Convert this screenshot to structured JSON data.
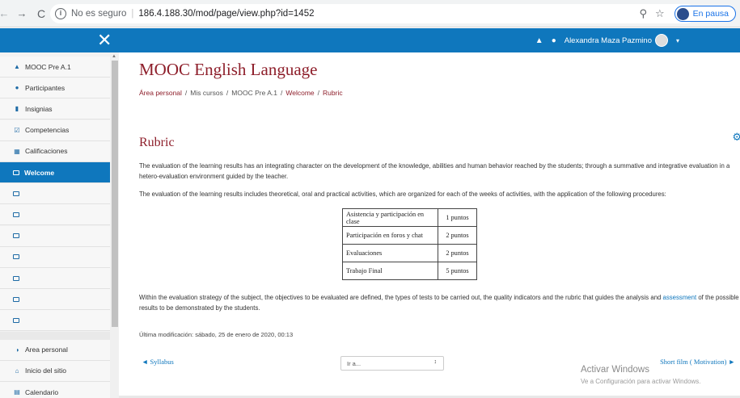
{
  "browser": {
    "back_glyph": "←",
    "forward_glyph": "→",
    "reload_glyph": "C",
    "info_glyph": "i",
    "not_secure": "No es seguro",
    "url": "186.4.188.30/mod/page/view.php?id=1452",
    "pause_label": "En pausa"
  },
  "navbar": {
    "close_glyph": "✕",
    "user_name": "Alexandra Maza Pazmino",
    "caret_glyph": "▾"
  },
  "sidebar": {
    "items": [
      {
        "label": "MOOC Pre A.1",
        "icon": "graduation-cap-icon",
        "glyph": "▲"
      },
      {
        "label": "Participantes",
        "icon": "users-icon",
        "glyph": "●"
      },
      {
        "label": "Insignias",
        "icon": "shield-icon",
        "glyph": "▮"
      },
      {
        "label": "Competencias",
        "icon": "checkbox-icon",
        "glyph": "☑"
      },
      {
        "label": "Calificaciones",
        "icon": "table-icon",
        "glyph": "▦"
      },
      {
        "label": "Welcome",
        "icon": "folder-icon",
        "active": true
      },
      {
        "label": "",
        "icon": "folder-icon"
      },
      {
        "label": "",
        "icon": "folder-icon"
      },
      {
        "label": "",
        "icon": "folder-icon"
      },
      {
        "label": "",
        "icon": "folder-icon"
      },
      {
        "label": "",
        "icon": "folder-icon"
      },
      {
        "label": "",
        "icon": "folder-icon"
      },
      {
        "label": "",
        "icon": "folder-icon"
      }
    ],
    "bottom_items": [
      {
        "label": "Area personal",
        "icon": "dashboard-icon",
        "glyph": "◑"
      },
      {
        "label": "Inicio del sitio",
        "icon": "home-icon",
        "glyph": "⌂"
      },
      {
        "label": "Calendario",
        "icon": "calendar-icon",
        "glyph": "▤"
      }
    ]
  },
  "main": {
    "course_title": "MOOC English Language",
    "breadcrumb": {
      "home": "Área personal",
      "sep": "/",
      "courses": "Mis cursos",
      "course": "MOOC Pre A.1",
      "section": "Welcome",
      "current": "Rubric"
    },
    "heading": "Rubric",
    "paragraph1": "The evaluation of the learning results has an integrating character on the development of the knowledge, abilities and human behavior reached by the students; through a summative and integrative evaluation in a hetero-evaluation environment guided by the teacher.",
    "paragraph2": "The evaluation of the learning results includes theoretical, oral and practical activities, which are organized for each of the weeks of activities, with the application of the following procedures:",
    "table": [
      {
        "criterion": "Asistencia y participación en clase",
        "points": "1 puntos"
      },
      {
        "criterion": "Participación en foros y chat",
        "points": "2 puntos"
      },
      {
        "criterion": "Evaluaciones",
        "points": "2 puntos"
      },
      {
        "criterion": "Trabajo Final",
        "points": "5 puntos"
      }
    ],
    "paragraph3_before": "Within the evaluation strategy of the subject, the objectives to be evaluated are defined, the types of tests to be carried out, the quality indicators and the rubric that guides the analysis and ",
    "paragraph3_link": "assessment",
    "paragraph3_after": " of the possible results to be demonstrated by the students.",
    "last_modified": "Última modificación: sábado, 25 de enero de 2020, 00:13",
    "prev_link": "◄ Syllabus",
    "jump_select": "Ir a...",
    "jump_arrow": "↕",
    "next_link": "Short film ( Motivation) ►"
  },
  "overlay": {
    "activate_title": "Activar Windows",
    "activate_sub": "Ve a Configuración para activar Windows."
  }
}
